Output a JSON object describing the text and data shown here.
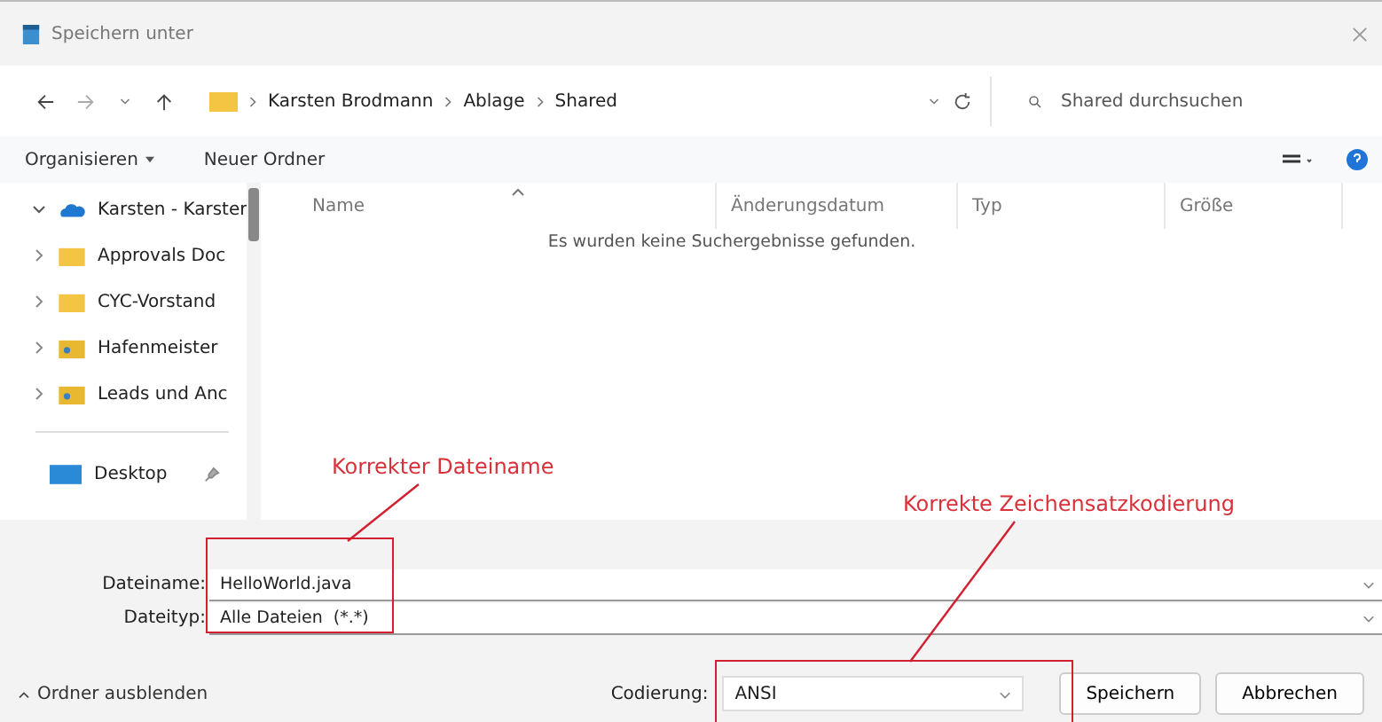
{
  "window": {
    "title": "Speichern unter"
  },
  "address": {
    "path": [
      "Karsten Brodmann",
      "Ablage",
      "Shared"
    ],
    "search_placeholder": "Shared durchsuchen"
  },
  "toolbar": {
    "organize": "Organisieren",
    "new_folder": "Neuer Ordner"
  },
  "sidebar": {
    "items": [
      {
        "label": "Karsten - Karster",
        "kind": "cloud",
        "expanded": true
      },
      {
        "label": "Approvals Doc",
        "kind": "folder",
        "expanded": false
      },
      {
        "label": "CYC-Vorstand",
        "kind": "folder",
        "expanded": false
      },
      {
        "label": "Hafenmeister",
        "kind": "shared",
        "expanded": false
      },
      {
        "label": "Leads und Anc",
        "kind": "shared",
        "expanded": false
      }
    ],
    "pinned": {
      "label": "Desktop"
    }
  },
  "table": {
    "columns": [
      "Name",
      "Änderungsdatum",
      "Typ",
      "Größe"
    ],
    "empty_message": "Es wurden keine Suchergebnisse gefunden."
  },
  "form": {
    "filename_label": "Dateiname:",
    "filename": "HelloWorld.java",
    "filetype_label": "Dateityp:",
    "filetype": "Alle Dateien  (*.*)"
  },
  "footer": {
    "hide_folders": "Ordner ausblenden",
    "encoding_label": "Codierung:",
    "encoding": "ANSI",
    "save": "Speichern",
    "cancel": "Abbrechen"
  },
  "annotations": [
    {
      "text": "Korrekter Dateiname"
    },
    {
      "text": "Korrekte Zeichensatzkodierung"
    }
  ]
}
